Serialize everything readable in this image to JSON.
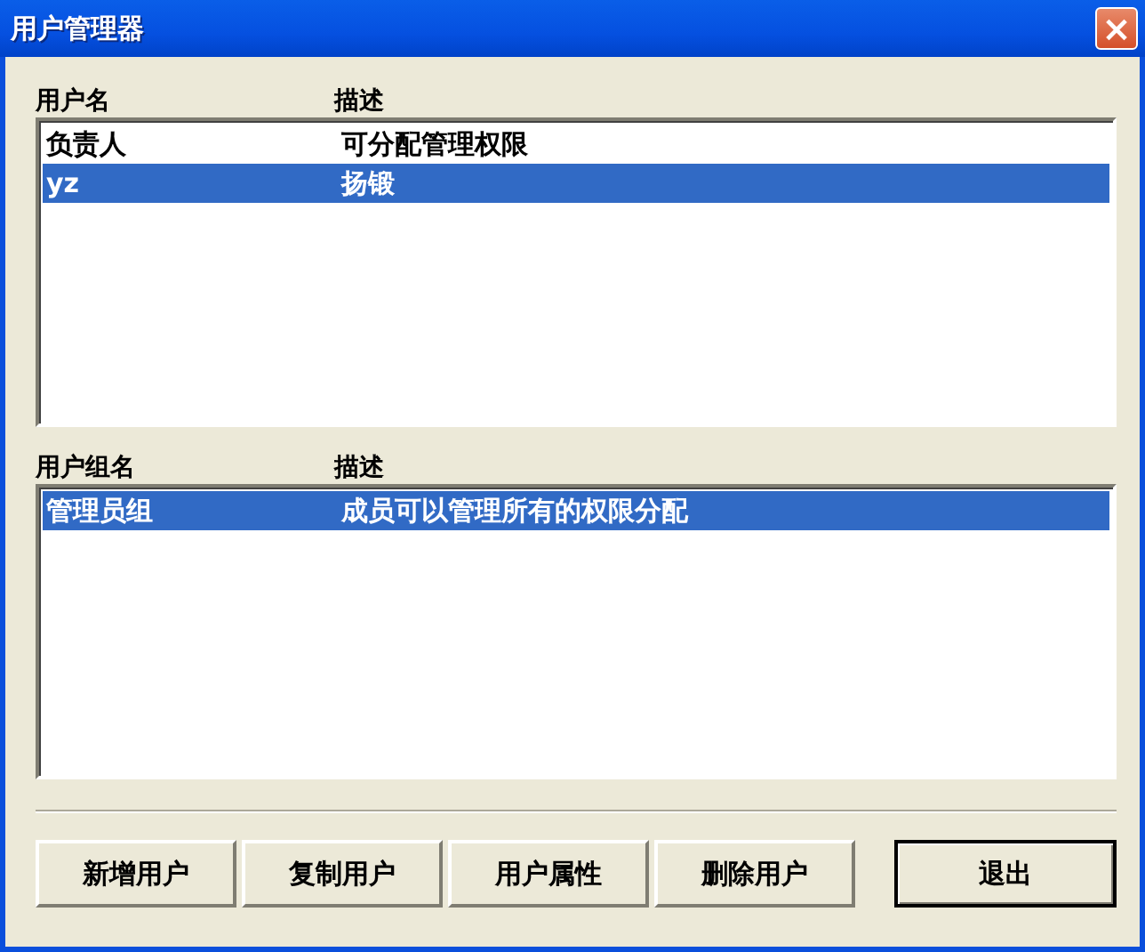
{
  "window": {
    "title": "用户管理器",
    "close": "×"
  },
  "users": {
    "columns": [
      "用户名",
      "描述"
    ],
    "rows": [
      {
        "cells": [
          "负责人",
          "可分配管理权限"
        ],
        "selected": false
      },
      {
        "cells": [
          "yz",
          "扬锻"
        ],
        "selected": true
      }
    ]
  },
  "groups": {
    "columns": [
      "用户组名",
      "描述"
    ],
    "rows": [
      {
        "cells": [
          "管理员组",
          "成员可以管理所有的权限分配"
        ],
        "selected": true
      }
    ]
  },
  "buttons": [
    {
      "label": "新增用户",
      "default": false
    },
    {
      "label": "复制用户",
      "default": false
    },
    {
      "label": "用户属性",
      "default": false
    },
    {
      "label": "删除用户",
      "default": false
    },
    {
      "label": "退出",
      "default": true
    }
  ]
}
